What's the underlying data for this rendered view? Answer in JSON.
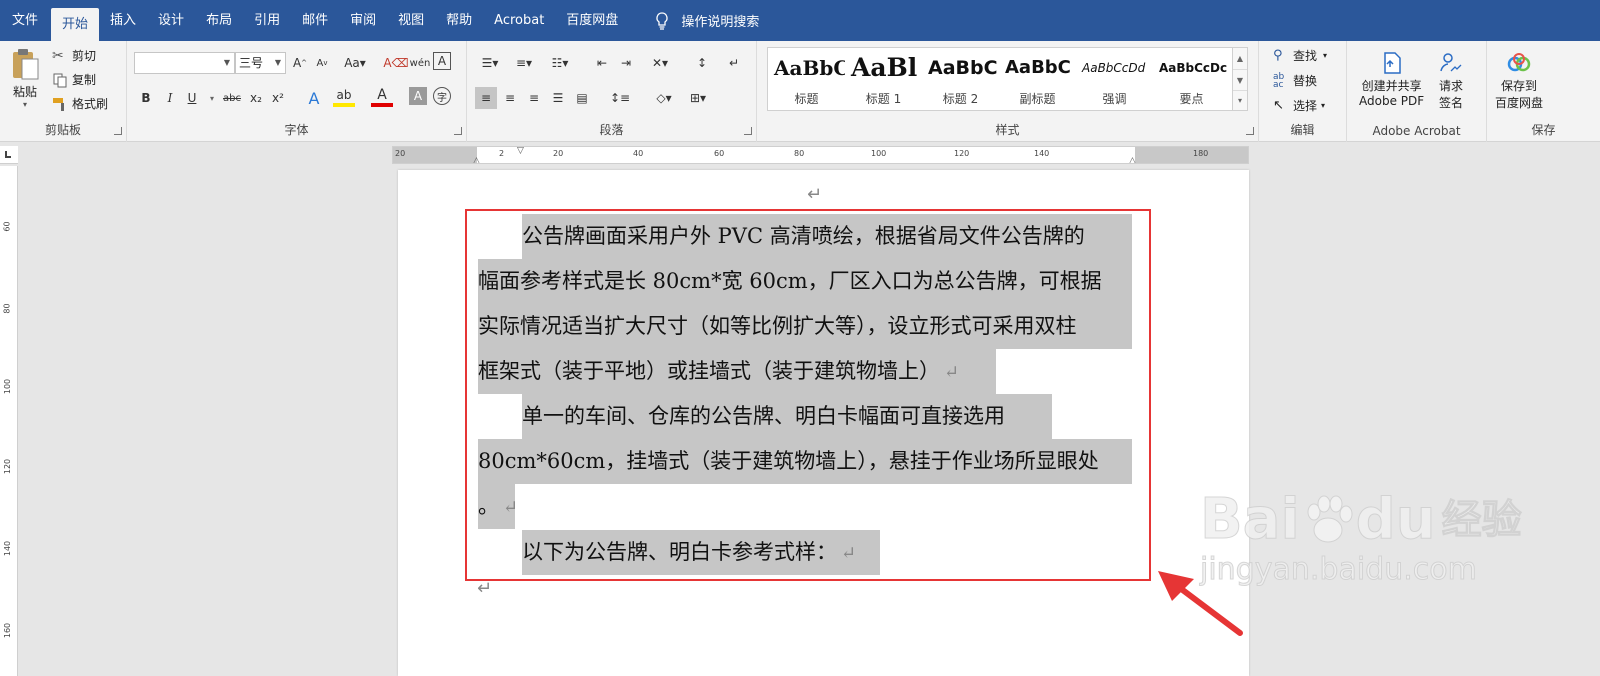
{
  "tabs": [
    "文件",
    "开始",
    "插入",
    "设计",
    "布局",
    "引用",
    "邮件",
    "审阅",
    "视图",
    "帮助",
    "Acrobat",
    "百度网盘"
  ],
  "active_tab": "开始",
  "tell_me": "操作说明搜索",
  "clipboard": {
    "paste": "粘贴",
    "cut": "剪切",
    "copy": "复制",
    "format_painter": "格式刷",
    "label": "剪贴板"
  },
  "font": {
    "family": "",
    "size": "三号",
    "label": "字体",
    "buttons": [
      "B",
      "I",
      "U",
      "abc",
      "x₂",
      "x²"
    ]
  },
  "paragraph": {
    "label": "段落"
  },
  "styles": {
    "label": "样式",
    "items": [
      {
        "preview": "AaBbC",
        "name": "标题"
      },
      {
        "preview": "AaBl",
        "name": "标题 1"
      },
      {
        "preview": "AaBbC",
        "name": "标题 2"
      },
      {
        "preview": "AaBbC",
        "name": "副标题"
      },
      {
        "preview": "AaBbCcDd",
        "name": "强调"
      },
      {
        "preview": "AaBbCcDc",
        "name": "要点"
      }
    ]
  },
  "editing": {
    "find": "查找",
    "replace": "替换",
    "select": "选择",
    "label": "编辑"
  },
  "acrobat": {
    "create_pdf_line1": "创建并共享",
    "create_pdf_line2": "Adobe PDF",
    "sign_line1": "请求",
    "sign_line2": "签名",
    "label": "Adobe Acrobat"
  },
  "save": {
    "line1": "保存到",
    "line2": "百度网盘",
    "label": "保存"
  },
  "ruler_h": [
    "20",
    "2",
    "20",
    "40",
    "60",
    "80",
    "100",
    "120",
    "140",
    "180"
  ],
  "ruler_v": [
    "60",
    "80",
    "100",
    "120",
    "140",
    "160"
  ],
  "document": {
    "lines": [
      "公告牌画面采用户外 PVC 高清喷绘，根据省局文件公告牌的",
      "幅面参考样式是长 80cm*宽 60cm，厂区入口为总公告牌，可根据",
      "实际情况适当扩大尺寸（如等比例扩大等），设立形式可采用双柱",
      "框架式（装于平地）或挂墙式（装于建筑物墙上）",
      "单一的车间、仓库的公告牌、明白卡幅面可直接选用",
      "80cm*60cm，挂墙式（装于建筑物墙上），悬挂于作业场所显眼处",
      "。",
      "以下为公告牌、明白卡参考式样："
    ],
    "paragraph_mark": "↵"
  },
  "watermark": {
    "brand": "Bai",
    "brand2": "du",
    "cn": "经验",
    "url": "jingyan.baidu.com"
  },
  "colors": {
    "ribbon_blue": "#2b579a",
    "highlight": "#c6c6c6",
    "annotation_red": "#e63535"
  }
}
